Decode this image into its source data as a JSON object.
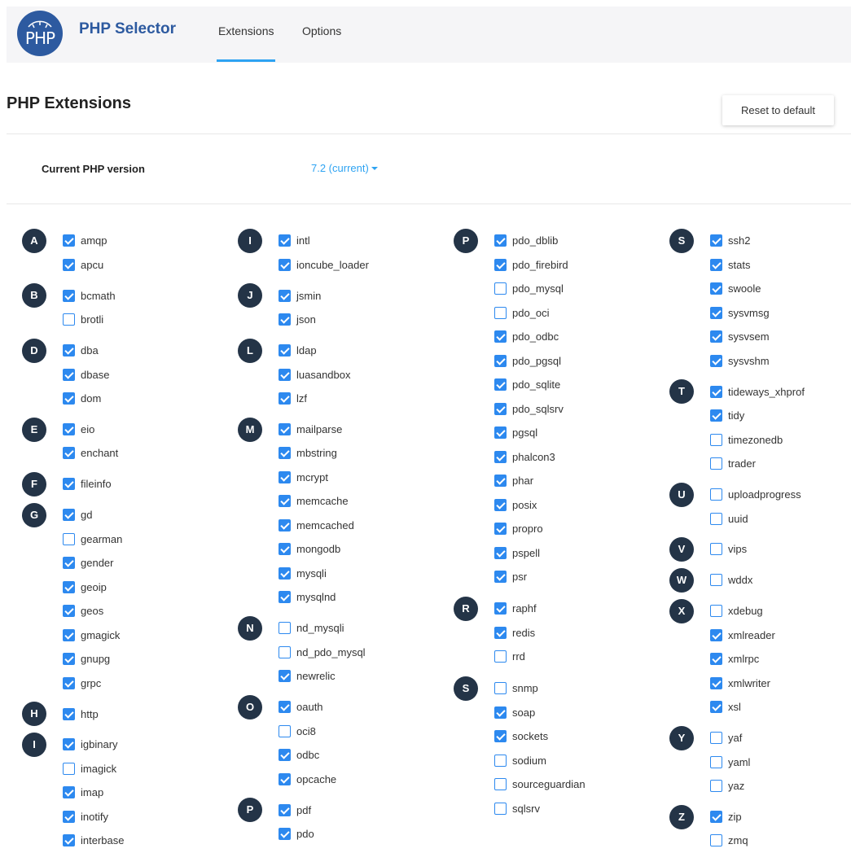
{
  "header": {
    "logo_text": "PHP",
    "app_title": "PHP Selector",
    "tabs": [
      {
        "label": "Extensions",
        "active": true
      },
      {
        "label": "Options",
        "active": false
      }
    ]
  },
  "page_title": "PHP Extensions",
  "reset_label": "Reset to default",
  "version": {
    "label": "Current PHP version",
    "value": "7.2 (current)"
  },
  "colors": {
    "accent": "#2ea3f2",
    "checkbox": "#2d89ef",
    "badge": "#243447",
    "logo": "#2d5aa0"
  },
  "columns": [
    [
      {
        "letter": "A",
        "items": [
          {
            "name": "amqp",
            "checked": true
          },
          {
            "name": "apcu",
            "checked": true
          }
        ]
      },
      {
        "letter": "B",
        "items": [
          {
            "name": "bcmath",
            "checked": true
          },
          {
            "name": "brotli",
            "checked": false
          }
        ]
      },
      {
        "letter": "D",
        "items": [
          {
            "name": "dba",
            "checked": true
          },
          {
            "name": "dbase",
            "checked": true
          },
          {
            "name": "dom",
            "checked": true
          }
        ]
      },
      {
        "letter": "E",
        "items": [
          {
            "name": "eio",
            "checked": true
          },
          {
            "name": "enchant",
            "checked": true
          }
        ]
      },
      {
        "letter": "F",
        "items": [
          {
            "name": "fileinfo",
            "checked": true
          }
        ]
      },
      {
        "letter": "G",
        "items": [
          {
            "name": "gd",
            "checked": true
          },
          {
            "name": "gearman",
            "checked": false
          },
          {
            "name": "gender",
            "checked": true
          },
          {
            "name": "geoip",
            "checked": true
          },
          {
            "name": "geos",
            "checked": true
          },
          {
            "name": "gmagick",
            "checked": true
          },
          {
            "name": "gnupg",
            "checked": true
          },
          {
            "name": "grpc",
            "checked": true
          }
        ]
      },
      {
        "letter": "H",
        "items": [
          {
            "name": "http",
            "checked": true
          }
        ]
      },
      {
        "letter": "I",
        "items": [
          {
            "name": "igbinary",
            "checked": true
          },
          {
            "name": "imagick",
            "checked": false
          },
          {
            "name": "imap",
            "checked": true
          },
          {
            "name": "inotify",
            "checked": true
          },
          {
            "name": "interbase",
            "checked": true
          }
        ]
      }
    ],
    [
      {
        "letter": "I",
        "items": [
          {
            "name": "intl",
            "checked": true
          },
          {
            "name": "ioncube_loader",
            "checked": true
          }
        ]
      },
      {
        "letter": "J",
        "items": [
          {
            "name": "jsmin",
            "checked": true
          },
          {
            "name": "json",
            "checked": true
          }
        ]
      },
      {
        "letter": "L",
        "items": [
          {
            "name": "ldap",
            "checked": true
          },
          {
            "name": "luasandbox",
            "checked": true
          },
          {
            "name": "lzf",
            "checked": true
          }
        ]
      },
      {
        "letter": "M",
        "items": [
          {
            "name": "mailparse",
            "checked": true
          },
          {
            "name": "mbstring",
            "checked": true
          },
          {
            "name": "mcrypt",
            "checked": true
          },
          {
            "name": "memcache",
            "checked": true
          },
          {
            "name": "memcached",
            "checked": true
          },
          {
            "name": "mongodb",
            "checked": true
          },
          {
            "name": "mysqli",
            "checked": true
          },
          {
            "name": "mysqlnd",
            "checked": true
          }
        ]
      },
      {
        "letter": "N",
        "items": [
          {
            "name": "nd_mysqli",
            "checked": false
          },
          {
            "name": "nd_pdo_mysql",
            "checked": false
          },
          {
            "name": "newrelic",
            "checked": true
          }
        ]
      },
      {
        "letter": "O",
        "items": [
          {
            "name": "oauth",
            "checked": true
          },
          {
            "name": "oci8",
            "checked": false
          },
          {
            "name": "odbc",
            "checked": true
          },
          {
            "name": "opcache",
            "checked": true
          }
        ]
      },
      {
        "letter": "P",
        "items": [
          {
            "name": "pdf",
            "checked": true
          },
          {
            "name": "pdo",
            "checked": true
          }
        ]
      }
    ],
    [
      {
        "letter": "P",
        "items": [
          {
            "name": "pdo_dblib",
            "checked": true
          },
          {
            "name": "pdo_firebird",
            "checked": true
          },
          {
            "name": "pdo_mysql",
            "checked": false
          },
          {
            "name": "pdo_oci",
            "checked": false
          },
          {
            "name": "pdo_odbc",
            "checked": true
          },
          {
            "name": "pdo_pgsql",
            "checked": true
          },
          {
            "name": "pdo_sqlite",
            "checked": true
          },
          {
            "name": "pdo_sqlsrv",
            "checked": true
          },
          {
            "name": "pgsql",
            "checked": true
          },
          {
            "name": "phalcon3",
            "checked": true
          },
          {
            "name": "phar",
            "checked": true
          },
          {
            "name": "posix",
            "checked": true
          },
          {
            "name": "propro",
            "checked": true
          },
          {
            "name": "pspell",
            "checked": true
          },
          {
            "name": "psr",
            "checked": true
          }
        ]
      },
      {
        "letter": "R",
        "items": [
          {
            "name": "raphf",
            "checked": true
          },
          {
            "name": "redis",
            "checked": true
          },
          {
            "name": "rrd",
            "checked": false
          }
        ]
      },
      {
        "letter": "S",
        "items": [
          {
            "name": "snmp",
            "checked": false
          },
          {
            "name": "soap",
            "checked": true
          },
          {
            "name": "sockets",
            "checked": true
          },
          {
            "name": "sodium",
            "checked": false
          },
          {
            "name": "sourceguardian",
            "checked": false
          },
          {
            "name": "sqlsrv",
            "checked": false
          }
        ]
      }
    ],
    [
      {
        "letter": "S",
        "items": [
          {
            "name": "ssh2",
            "checked": true
          },
          {
            "name": "stats",
            "checked": true
          },
          {
            "name": "swoole",
            "checked": true
          },
          {
            "name": "sysvmsg",
            "checked": true
          },
          {
            "name": "sysvsem",
            "checked": true
          },
          {
            "name": "sysvshm",
            "checked": true
          }
        ]
      },
      {
        "letter": "T",
        "items": [
          {
            "name": "tideways_xhprof",
            "checked": true
          },
          {
            "name": "tidy",
            "checked": true
          },
          {
            "name": "timezonedb",
            "checked": false
          },
          {
            "name": "trader",
            "checked": false
          }
        ]
      },
      {
        "letter": "U",
        "items": [
          {
            "name": "uploadprogress",
            "checked": false
          },
          {
            "name": "uuid",
            "checked": false
          }
        ]
      },
      {
        "letter": "V",
        "items": [
          {
            "name": "vips",
            "checked": false
          }
        ]
      },
      {
        "letter": "W",
        "items": [
          {
            "name": "wddx",
            "checked": false
          }
        ]
      },
      {
        "letter": "X",
        "items": [
          {
            "name": "xdebug",
            "checked": false
          },
          {
            "name": "xmlreader",
            "checked": true
          },
          {
            "name": "xmlrpc",
            "checked": true
          },
          {
            "name": "xmlwriter",
            "checked": true
          },
          {
            "name": "xsl",
            "checked": true
          }
        ]
      },
      {
        "letter": "Y",
        "items": [
          {
            "name": "yaf",
            "checked": false
          },
          {
            "name": "yaml",
            "checked": false
          },
          {
            "name": "yaz",
            "checked": false
          }
        ]
      },
      {
        "letter": "Z",
        "items": [
          {
            "name": "zip",
            "checked": true
          },
          {
            "name": "zmq",
            "checked": false
          }
        ]
      }
    ]
  ]
}
